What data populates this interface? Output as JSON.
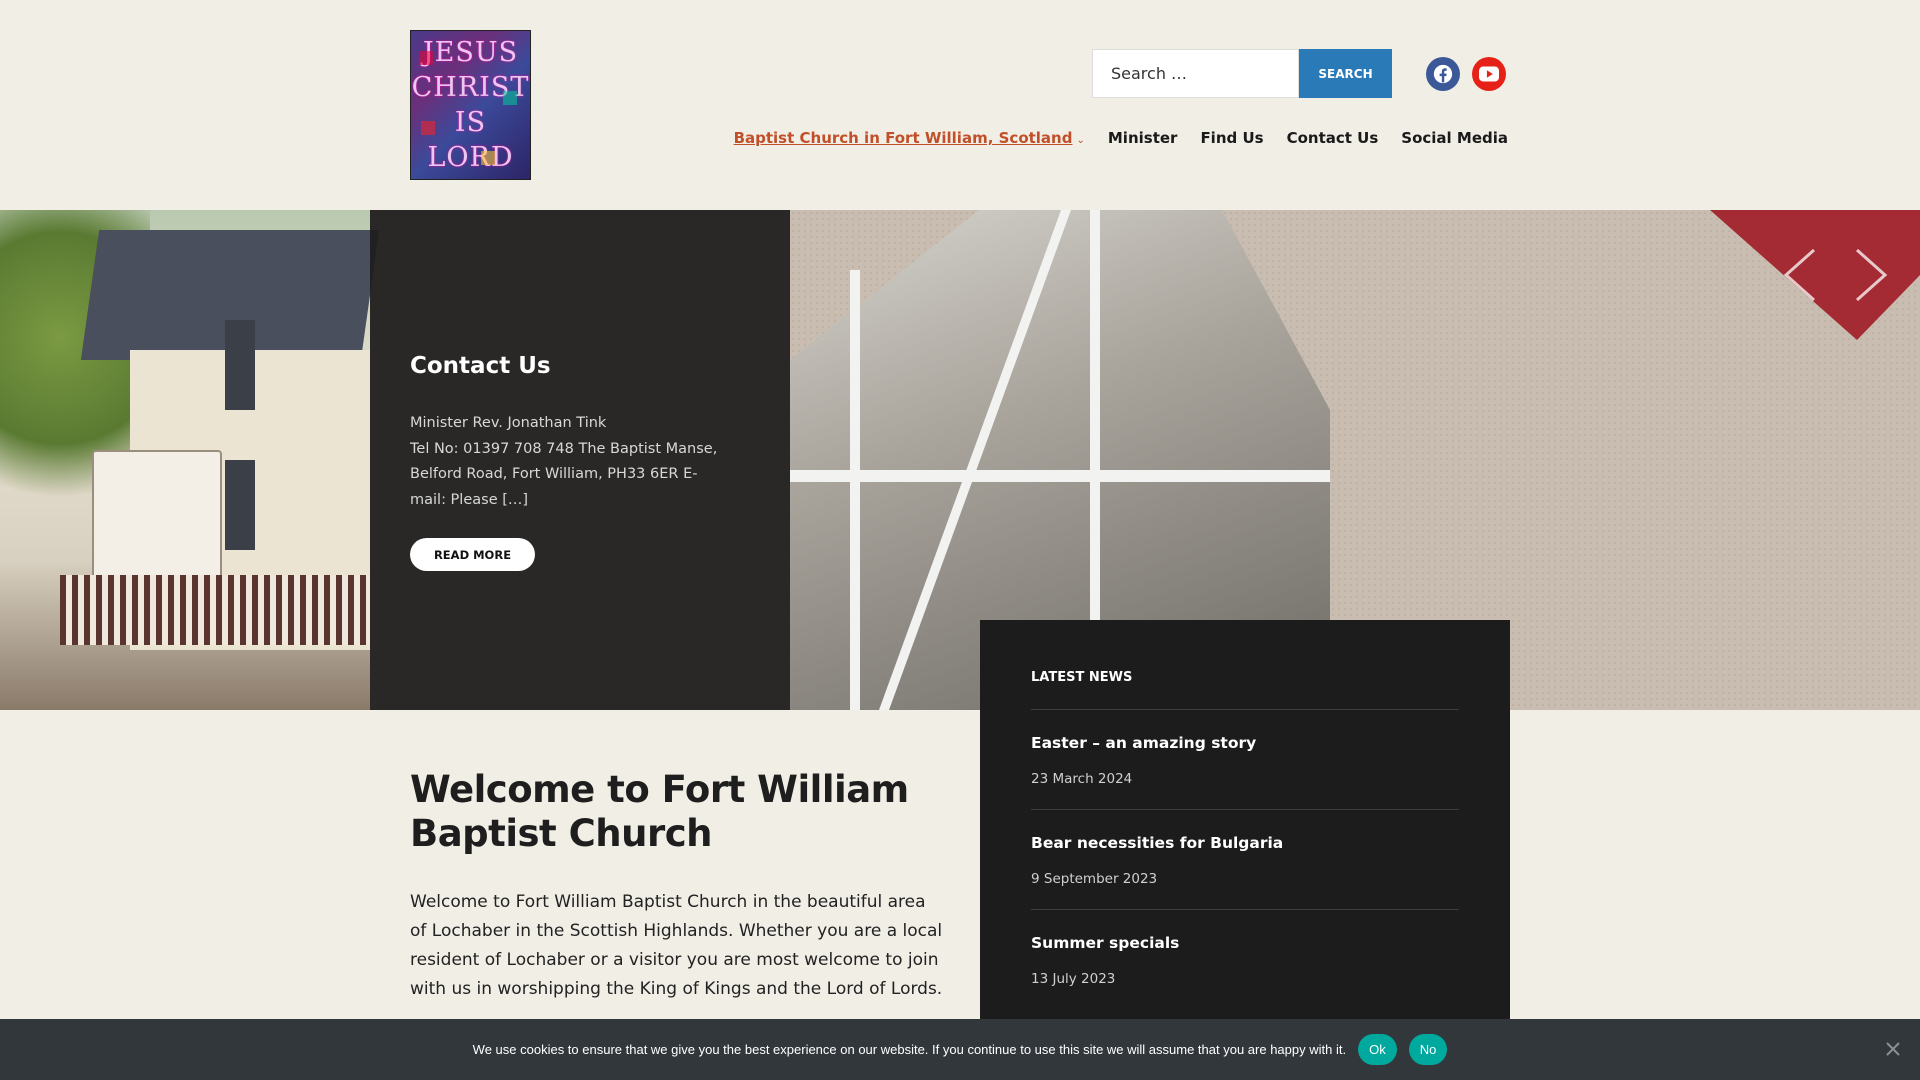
{
  "logo": {
    "lines": [
      "JESUS",
      "CHRIST",
      "IS",
      "LORD"
    ]
  },
  "search": {
    "placeholder": "Search …",
    "button_label": "Search"
  },
  "social": [
    {
      "name": "facebook-icon",
      "color": "#3b5998"
    },
    {
      "name": "youtube-icon",
      "color": "#e62117"
    }
  ],
  "nav": {
    "items": [
      {
        "label": "Baptist Church in Fort William, Scotland",
        "active": true,
        "has_submenu": true
      },
      {
        "label": "Minister"
      },
      {
        "label": "Find Us"
      },
      {
        "label": "Contact Us"
      },
      {
        "label": "Social Media"
      }
    ]
  },
  "slide": {
    "title": "Contact Us",
    "text": "Minister  Rev. Jonathan Tink\n     Tel No: 01397 708 748 The Baptist Manse, Belford Road, Fort William, PH33 6ER E-mail: Please […]",
    "button_label": "Read more"
  },
  "welcome": {
    "title": "Welcome to Fort William Baptist Church",
    "text": "Welcome to Fort William Baptist Church in the beautiful area of Lochaber in the Scottish Highlands. Whether you are a local resident of Lochaber or a visitor you are most welcome to join with us in worshipping the King of Kings and the Lord of Lords."
  },
  "news": {
    "heading": "Latest News",
    "items": [
      {
        "title": "Easter – an amazing story",
        "date": "23 March 2024"
      },
      {
        "title": "Bear necessities for Bulgaria",
        "date": "9 September 2023"
      },
      {
        "title": "Summer specials",
        "date": "13 July 2023"
      }
    ]
  },
  "cookie": {
    "text": "We use cookies to ensure that we give you the best experience on our website. If you continue to use this site we will assume that you are happy with it.",
    "ok_label": "Ok",
    "no_label": "No"
  },
  "colors": {
    "background": "#f1eee6",
    "accent": "#c1502a",
    "search_button": "#2a7ab8",
    "cookie_button": "#00a99d",
    "dark_panel": "#1c1c1c"
  }
}
